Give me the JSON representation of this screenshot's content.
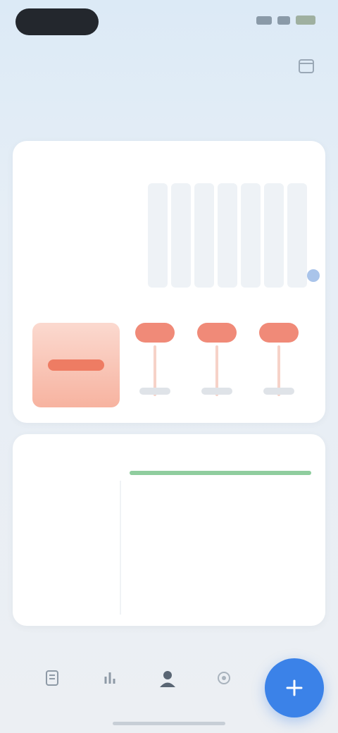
{
  "status_bar": {
    "time": ""
  },
  "header": {
    "title": "",
    "icon": "calendar-icon"
  },
  "tabs": [
    {
      "label": "",
      "active": true
    },
    {
      "label": "",
      "active": false
    },
    {
      "label": "",
      "active": false
    },
    {
      "label": "",
      "active": false
    },
    {
      "label": "",
      "active": false
    },
    {
      "label": "",
      "active": false
    }
  ],
  "overview_card": {
    "title": "",
    "summary_label": "",
    "week_days": [
      "",
      "",
      "",
      "",
      "",
      "",
      ""
    ],
    "medications": [
      {
        "name": ""
      },
      {
        "name": ""
      },
      {
        "name": ""
      }
    ],
    "colors": {
      "accent_red": "#ee7c63",
      "cap_red": "#f08a78"
    }
  },
  "progress_card": {
    "title": "",
    "rows": [
      {
        "label": "",
        "sub": ""
      },
      {
        "label": "",
        "sub": ""
      },
      {
        "label": "",
        "sub": ""
      }
    ],
    "progress": 1.0,
    "colors": {
      "progress": "#8fcd9e"
    }
  },
  "bottom_nav": {
    "items": [
      {
        "icon": "list-icon",
        "label": ""
      },
      {
        "icon": "chart-icon",
        "label": ""
      },
      {
        "icon": "person-icon",
        "label": ""
      },
      {
        "icon": "settings-icon",
        "label": ""
      }
    ],
    "fab_icon": "plus-icon",
    "colors": {
      "fab": "#3b82e8"
    }
  }
}
